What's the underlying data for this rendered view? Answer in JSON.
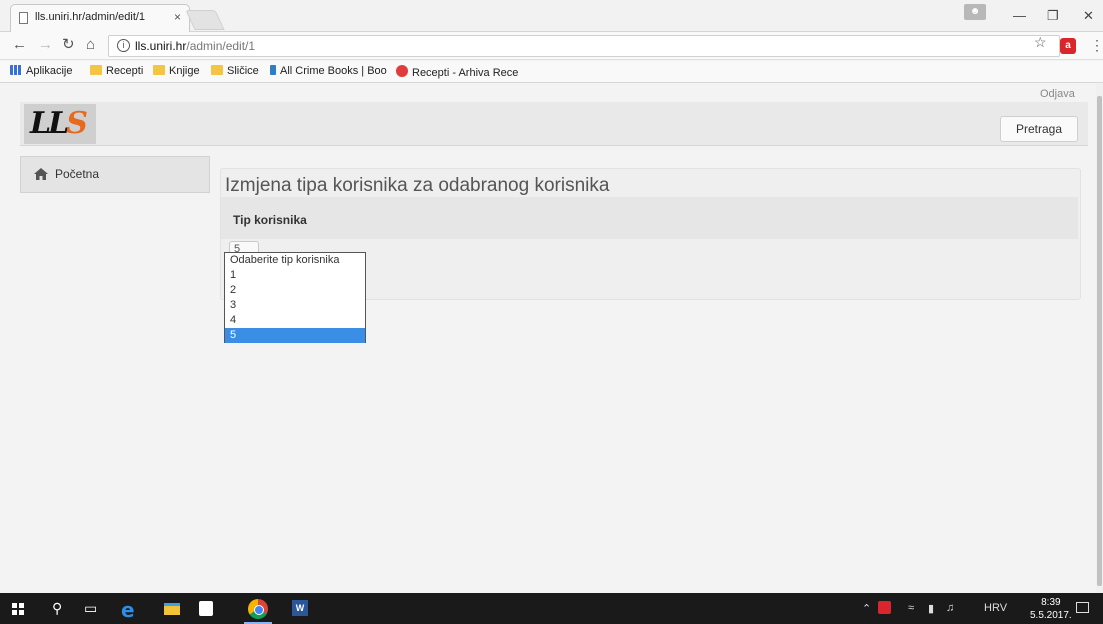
{
  "browser": {
    "tab_title": "lls.uniri.hr/admin/edit/1",
    "tab_close": "×",
    "url_host": "lls.uniri.hr",
    "url_path": "/admin/edit/1",
    "bookmarks": [
      "Aplikacije",
      "Recepti",
      "Knjige",
      "Sličice",
      "All Crime Books | Boo",
      "Recepti - Arhiva Rece"
    ]
  },
  "header": {
    "logo_text": "LL",
    "logo_accent": "S",
    "logout": "Odjava",
    "search_button": "Pretraga"
  },
  "sidebar": {
    "items": [
      {
        "label": "Početna",
        "icon": "home-icon"
      }
    ]
  },
  "main": {
    "title": "Izmjena tipa korisnika za odabranog korisnika",
    "field_label": "Tip korisnika",
    "select_value": "5",
    "options": [
      "Odaberite tip korisnika",
      "1",
      "2",
      "3",
      "4",
      "5"
    ],
    "selected_option": "5"
  },
  "taskbar": {
    "tray_lang": "HRV",
    "time": "8:39",
    "date": "5.5.2017."
  },
  "colors": {
    "accent_selection": "#3a8ee6",
    "logo_orange": "#e8681c"
  }
}
